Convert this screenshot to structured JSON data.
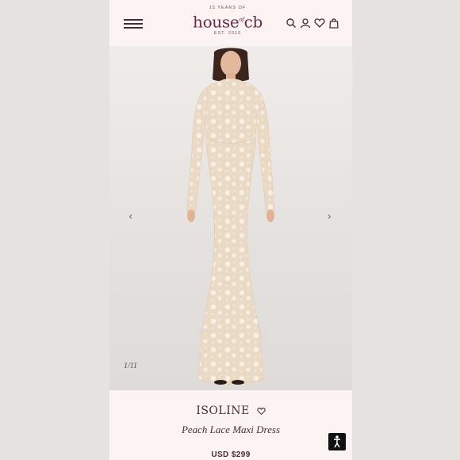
{
  "header": {
    "logo_top": "15 YEARS OF",
    "logo_word": "house",
    "logo_of": "of",
    "logo_cb": "cb",
    "logo_est": "EST. 2010",
    "icons": [
      "search-icon",
      "account-icon",
      "wishlist-heart-icon",
      "bag-icon"
    ]
  },
  "gallery": {
    "counter": "1/11",
    "prev_icon": "‹",
    "next_icon": "›"
  },
  "product": {
    "name": "ISOLINE",
    "subtitle": "Peach Lace Maxi Dress",
    "price": "USD $299"
  },
  "colors": {
    "brand": "#6b2a48",
    "text": "#4a2b35",
    "dress": "#efe1cf",
    "lace": "#f7eee2",
    "page_bg": "#fbf4f2"
  }
}
